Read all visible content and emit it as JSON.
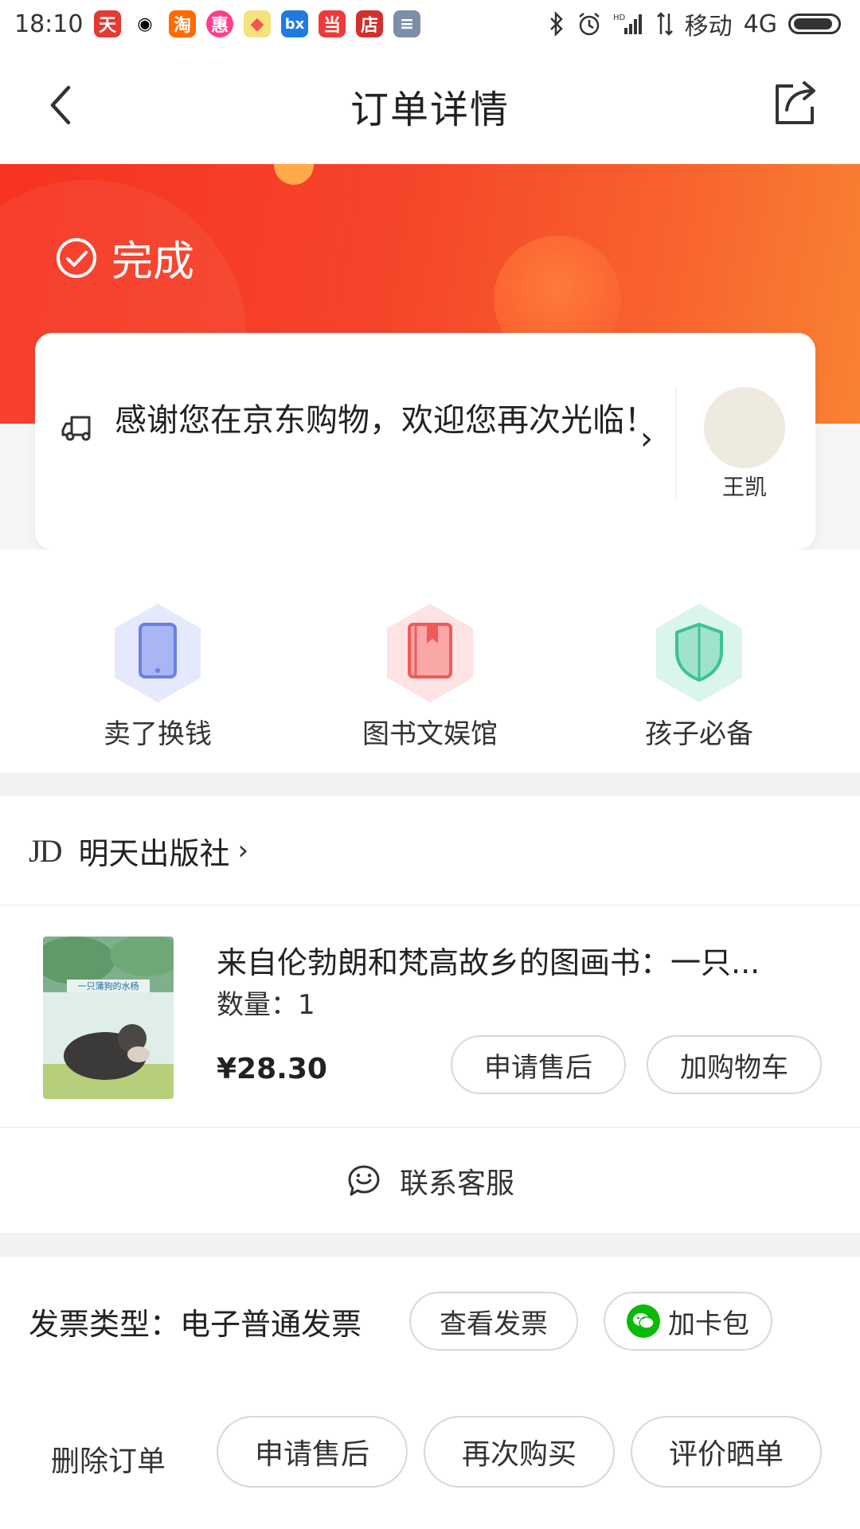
{
  "status_bar": {
    "time": "18:10",
    "carrier": "移动",
    "network": "4G",
    "app_icons": [
      {
        "name": "tmall-icon",
        "color": "#e53935",
        "glyph": "天"
      },
      {
        "name": "qq-icon",
        "color": "#ffffff",
        "glyph": "🐧"
      },
      {
        "name": "taobao-icon",
        "color": "#ff6a00",
        "glyph": "淘"
      },
      {
        "name": "pink-app-icon",
        "color": "#ff3d8b",
        "glyph": "惠"
      },
      {
        "name": "map-app-icon",
        "color": "#f4e27a",
        "glyph": "◆"
      },
      {
        "name": "blue-app-icon",
        "color": "#1f7ae0",
        "glyph": "bx"
      },
      {
        "name": "dangdang-icon",
        "color": "#ee3a3a",
        "glyph": "当"
      },
      {
        "name": "shop-icon",
        "color": "#d32f2f",
        "glyph": "店"
      },
      {
        "name": "gray-app-icon",
        "color": "#7d8ea6",
        "glyph": "≡"
      }
    ]
  },
  "nav": {
    "title": "订单详情"
  },
  "order_status": {
    "label": "完成"
  },
  "delivery": {
    "message": "感谢您在京东购物，欢迎您再次光临！",
    "courier_name": "王凯"
  },
  "services": [
    {
      "label": "卖了换钱",
      "icon": "tablet-icon",
      "accent": "#6b7fe3"
    },
    {
      "label": "图书文娱馆",
      "icon": "book-icon",
      "accent": "#f05a5a"
    },
    {
      "label": "孩子必备",
      "icon": "shield-icon",
      "accent": "#3fbf9a"
    }
  ],
  "shop": {
    "logo": "JD",
    "name": "明天出版社",
    "chevron": "›"
  },
  "product": {
    "title": "来自伦勃朗和梵高故乡的图画书：一只...",
    "quantity": "数量：1",
    "price": "¥28.30",
    "after_sale_label": "申请售后",
    "add_cart_label": "加购物车"
  },
  "contact": {
    "label": "联系客服"
  },
  "invoice": {
    "type": "发票类型：电子普通发票",
    "view_label": "查看发票",
    "card_label": "加卡包"
  },
  "bottom_actions": {
    "delete_label": "删除订单",
    "after_sale_label": "申请售后",
    "rebuy_label": "再次购买",
    "review_label": "评价晒单"
  }
}
